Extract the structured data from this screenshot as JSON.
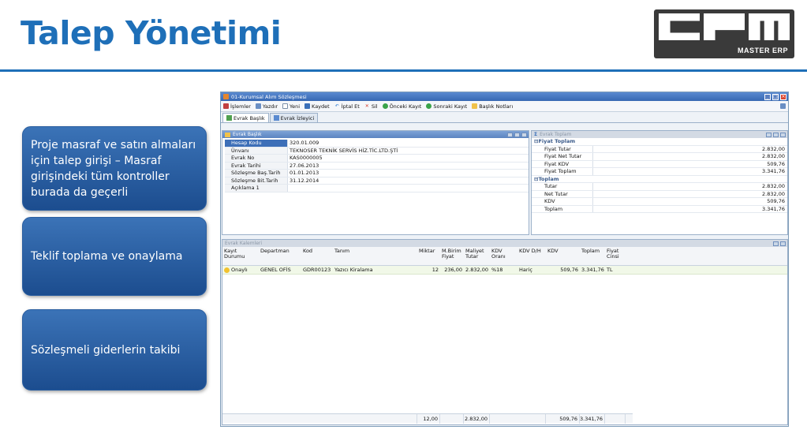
{
  "slide": {
    "title": "Talep Yönetimi",
    "logo_subtitle": "MASTER ERP",
    "boxes": [
      "Proje masraf ve satın almaları için talep girişi – Masraf girişindeki tüm kontroller burada da geçerli",
      "Teklif toplama ve onaylama",
      "Sözleşmeli giderlerin takibi"
    ]
  },
  "window": {
    "title": "01-Kurumsal Alım Sözleşmesi",
    "toolbar": [
      "İşlemler",
      "Yazdır",
      "Yeni",
      "Kaydet",
      "İptal Et",
      "Sil",
      "Önceki Kayıt",
      "Sonraki Kayıt",
      "Başlık Notları"
    ],
    "tabs": [
      "Evrak Başlık",
      "Evrak İzleyici"
    ],
    "header_panel": {
      "title": "Evrak Başlık",
      "rows": [
        {
          "label": "Hesap Kodu",
          "value": "320.01.009"
        },
        {
          "label": "Ünvanı",
          "value": "TEKNOSER TEKNİK SERVİS HİZ.TİC.LTD.ŞTİ"
        },
        {
          "label": "Evrak No",
          "value": "KAS0000005"
        },
        {
          "label": "Evrak Tarihi",
          "value": "27.06.2013"
        },
        {
          "label": "Sözleşme Baş.Tarih",
          "value": "01.01.2013"
        },
        {
          "label": "Sözleşme Bit.Tarih",
          "value": "31.12.2014"
        },
        {
          "label": "Açıklama 1",
          "value": ""
        }
      ]
    },
    "totals_panel": {
      "title": "Evrak Toplam",
      "groups": [
        {
          "name": "Fiyat Toplam",
          "rows": [
            {
              "label": "Fiyat Tutar",
              "value": "2.832,00"
            },
            {
              "label": "Fiyat Net Tutar",
              "value": "2.832,00"
            },
            {
              "label": "Fiyat KDV",
              "value": "509,76"
            },
            {
              "label": "Fiyat Toplam",
              "value": "3.341,76"
            }
          ]
        },
        {
          "name": "Toplam",
          "rows": [
            {
              "label": "Tutar",
              "value": "2.832,00"
            },
            {
              "label": "Net Tutar",
              "value": "2.832,00"
            },
            {
              "label": "KDV",
              "value": "509,76"
            },
            {
              "label": "Toplam",
              "value": "3.341,76"
            }
          ]
        }
      ]
    },
    "lines_panel": {
      "title": "Evrak Kalemleri",
      "columns": [
        "Kayıt Durumu",
        "Departman",
        "Kod",
        "Tanım",
        "Miktar",
        "M.Birim Fiyat",
        "Maliyet Tutar",
        "KDV Oranı",
        "KDV D/H",
        "KDV",
        "Toplam",
        "Fiyat Cinsi"
      ],
      "rows": [
        [
          "Onaylı",
          "GENEL OFİS",
          "GDR00123",
          "Yazıcı Kiralama",
          "12",
          "236,00",
          "2.832,00",
          "%18",
          "Hariç",
          "509,76",
          "3.341,76",
          "TL"
        ]
      ],
      "footer": {
        "miktar": "12,00",
        "maliyet": "2.832,00",
        "kdv": "509,76",
        "toplam": "3.341,76"
      }
    }
  }
}
